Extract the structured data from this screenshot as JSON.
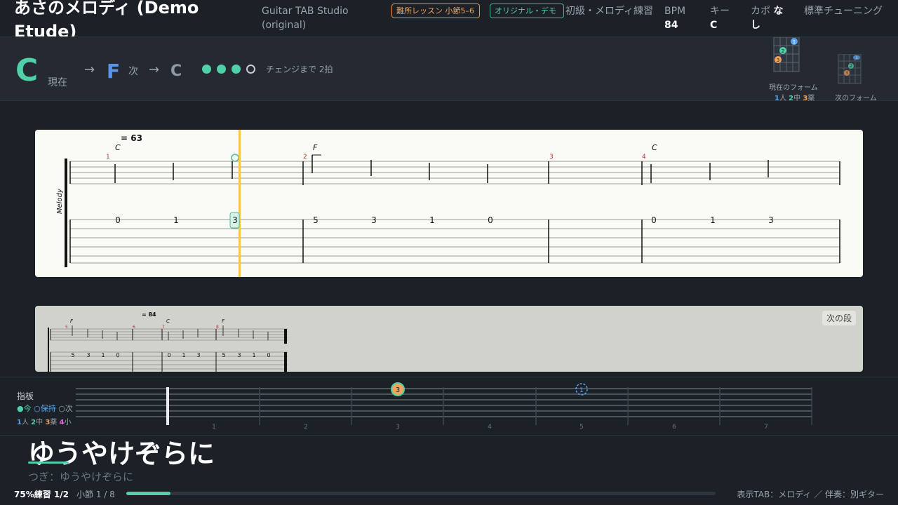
{
  "header": {
    "title": "あさのメロディ (Demo Etude)",
    "subtitle": "Guitar TAB Studio (original)",
    "lesson_badge": "難所レッスン 小節5–6",
    "demo_badge": "オリジナル・デモ",
    "level": "初級・メロディ練習",
    "bpm_label": "BPM",
    "bpm_value": "84",
    "key_label": "キー",
    "key_value": "C",
    "capo_label": "カポ",
    "capo_value": "なし",
    "tuning": "標準チューニング"
  },
  "chord_bar": {
    "current_chord": "C",
    "current_label": "現在",
    "arrow": "→",
    "next_chord": "F",
    "next_label": "次",
    "after_chord": "C",
    "beats_on": 3,
    "beats_total": 4,
    "change_label": "チェンジまで 2拍",
    "current_form_label": "現在のフォーム",
    "next_form_label": "次のフォーム",
    "finger_legend": [
      {
        "num": "1",
        "name": "人"
      },
      {
        "num": "2",
        "name": "中"
      },
      {
        "num": "3",
        "name": "薬"
      }
    ]
  },
  "score_main": {
    "tempo": "= 63",
    "staff_label": "Melody",
    "chords": [
      "C",
      "F",
      "C"
    ],
    "measure_numbers": [
      "1",
      "2",
      "3",
      "4"
    ],
    "tab_numbers": [
      "0",
      "1",
      "3",
      "5",
      "3",
      "1",
      "0",
      "0",
      "1",
      "3"
    ]
  },
  "score_next": {
    "button": "次の段",
    "tempo": "= 84",
    "chords": [
      "F",
      "C",
      "F"
    ],
    "measure_numbers": [
      "5",
      "6",
      "7",
      "8"
    ],
    "tab_numbers": [
      "5",
      "3",
      "1",
      "0",
      "0",
      "1",
      "3",
      "5",
      "3",
      "1",
      "0"
    ]
  },
  "fretboard": {
    "label": "指板",
    "legend_now": "●今",
    "legend_hold": "○保持",
    "legend_next": "○次",
    "fingers": [
      {
        "num": "1",
        "name": "人"
      },
      {
        "num": "2",
        "name": "中"
      },
      {
        "num": "3",
        "name": "薬"
      },
      {
        "num": "4",
        "name": "小"
      }
    ],
    "fret_numbers": [
      "1",
      "2",
      "3",
      "4",
      "5",
      "6",
      "7"
    ],
    "current_marker": "3",
    "next_marker": "1"
  },
  "lyrics": {
    "current": "ゆうやけぞらに",
    "next": "つぎ：ゆうやけぞらに"
  },
  "footer": {
    "mode": "75%練習 1/2",
    "bar_position": "小節 1 / 8",
    "progress": 0.075,
    "tab_info": "表示TAB：メロディ ／ 伴奏：別ギター"
  },
  "colors": {
    "accent": "#4fd0a7",
    "next": "#5a95ea",
    "warning": "#f0a35a",
    "playhead": "#f5c84a"
  }
}
